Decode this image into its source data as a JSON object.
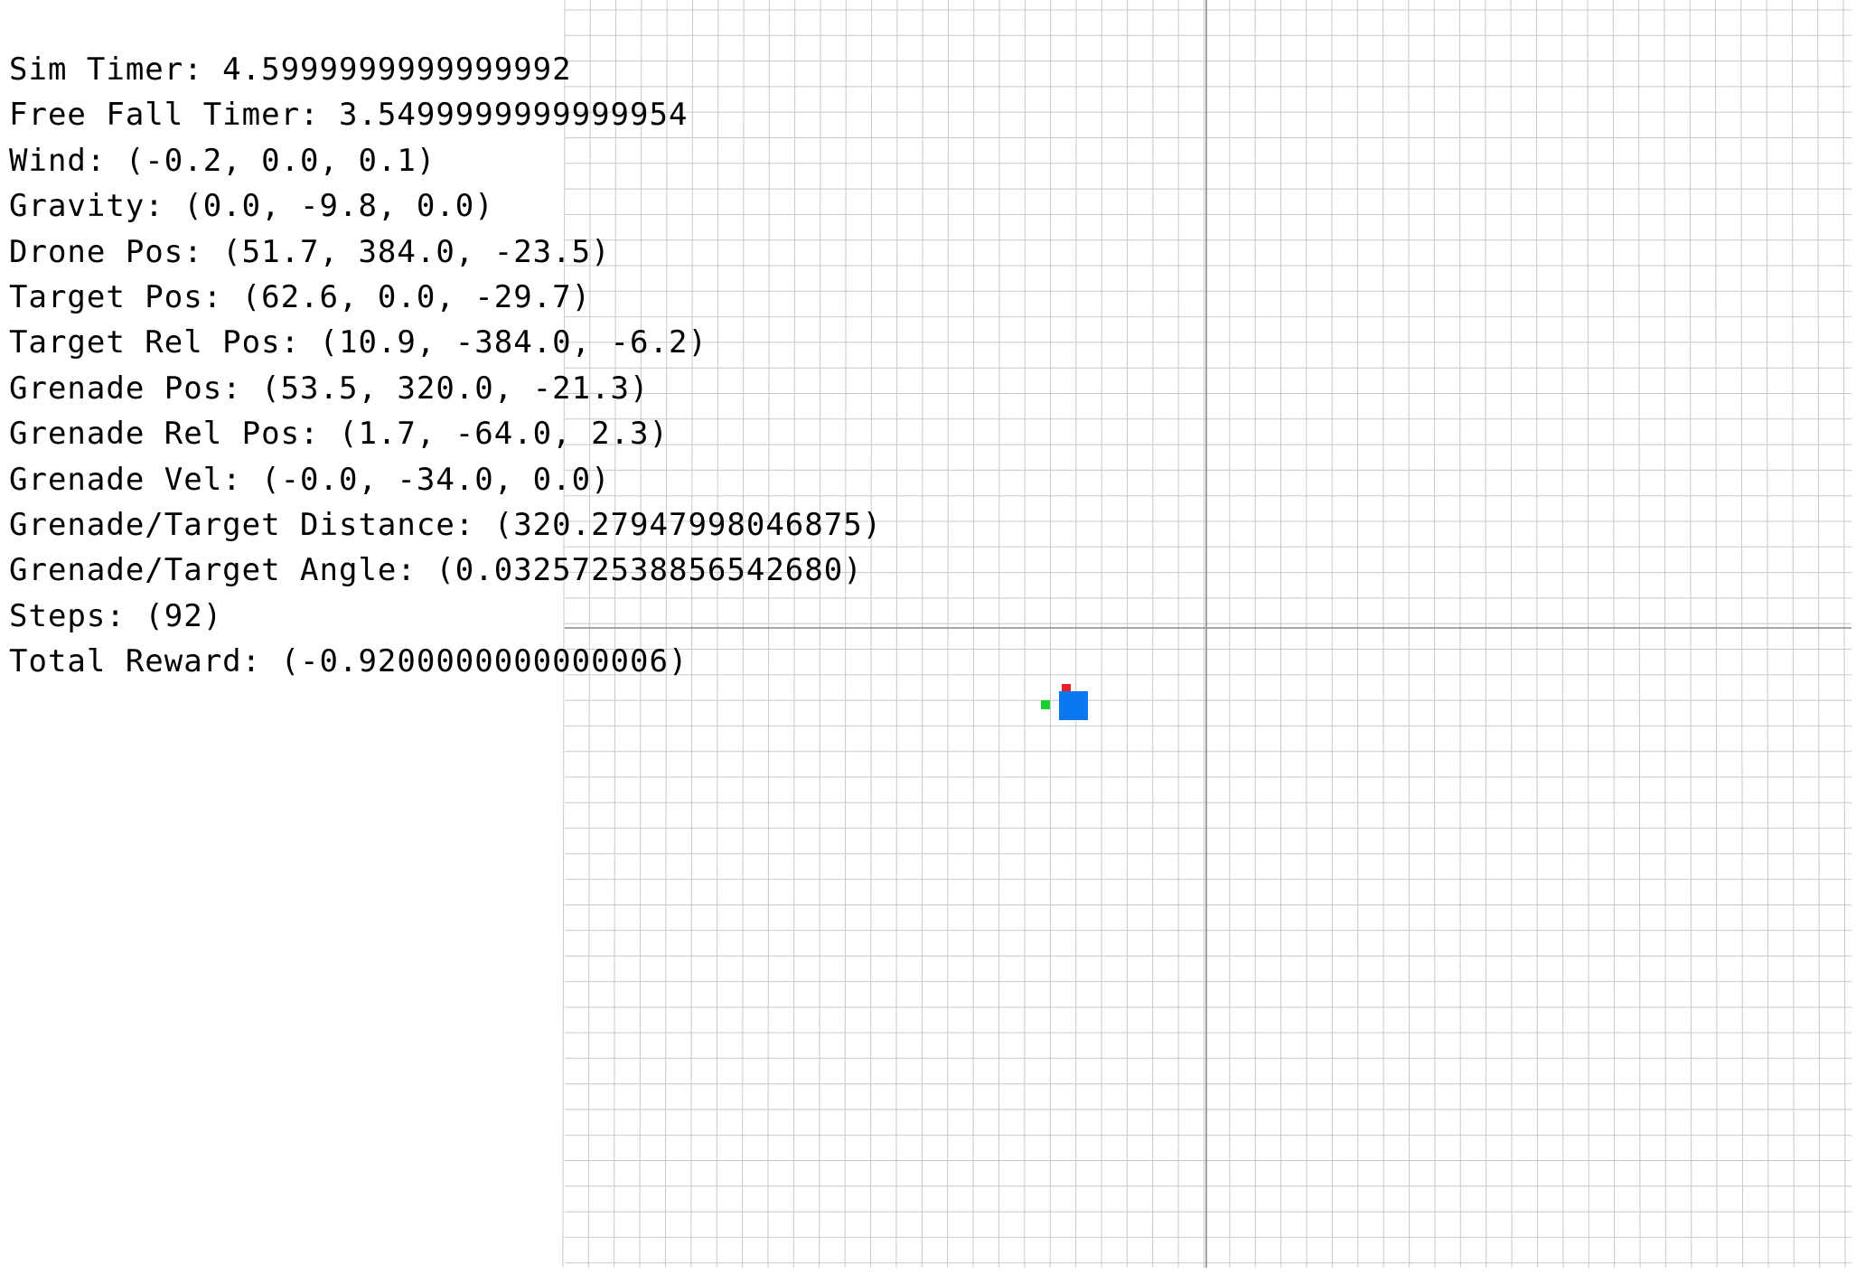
{
  "hud": {
    "sim_timer": "Sim Timer: 4.5999999999999992",
    "free_fall_timer": "Free Fall Timer: 3.5499999999999954",
    "wind": "Wind: (-0.2, 0.0, 0.1)",
    "gravity": "Gravity: (0.0, -9.8, 0.0)",
    "drone_pos": "Drone Pos: (51.7, 384.0, -23.5)",
    "target_pos": "Target Pos: (62.6, 0.0, -29.7)",
    "target_rel_pos": "Target Rel Pos: (10.9, -384.0, -6.2)",
    "grenade_pos": "Grenade Pos: (53.5, 320.0, -21.3)",
    "grenade_rel_pos": "Grenade Rel Pos: (1.7, -64.0, 2.3)",
    "grenade_vel": "Grenade Vel: (-0.0, -34.0, 0.0)",
    "grenade_target_distance": "Grenade/Target Distance: (320.27947998046875)",
    "grenade_target_angle": "Grenade/Target Angle: (0.032572538856542680)",
    "steps": "Steps: (92)",
    "total_reward": "Total Reward: (-0.9200000000000006)"
  },
  "colors": {
    "background": "#ffffff",
    "grid_line": "#c8c8c8",
    "axis_line": "#8c8c8c",
    "drone": "#0a78f0",
    "grenade": "#e8202a",
    "target": "#18d030",
    "text": "#000000"
  },
  "entities": {
    "drone": "drone-marker",
    "grenade": "grenade-marker",
    "target": "target-marker"
  }
}
